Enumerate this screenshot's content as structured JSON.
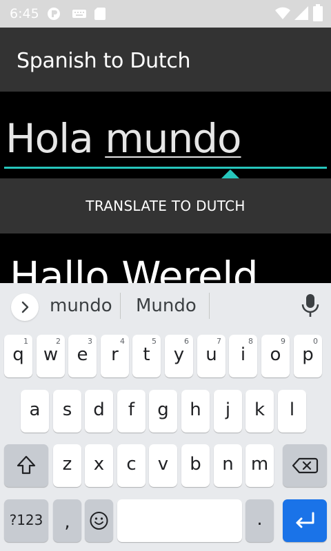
{
  "status_bar": {
    "time": "6:45",
    "left_icons": [
      "app-notification-icon",
      "keyboard-icon",
      "sd-card-icon"
    ],
    "right_icons": [
      "wifi-icon",
      "signal-icon",
      "battery-icon"
    ]
  },
  "app_bar": {
    "title": "Spanish to Dutch"
  },
  "input": {
    "text_plain": "Hola ",
    "text_composing": "mundo"
  },
  "translate_button": {
    "label": "TRANSLATE TO DUTCH"
  },
  "output": {
    "text": "Hallo Wereld"
  },
  "keyboard": {
    "suggestions": [
      "mundo",
      "Mundo"
    ],
    "row1": [
      {
        "ch": "q",
        "hint": "1"
      },
      {
        "ch": "w",
        "hint": "2"
      },
      {
        "ch": "e",
        "hint": "3"
      },
      {
        "ch": "r",
        "hint": "4"
      },
      {
        "ch": "t",
        "hint": "5"
      },
      {
        "ch": "y",
        "hint": "6"
      },
      {
        "ch": "u",
        "hint": "7"
      },
      {
        "ch": "i",
        "hint": "8"
      },
      {
        "ch": "o",
        "hint": "9"
      },
      {
        "ch": "p",
        "hint": "0"
      }
    ],
    "row2": [
      "a",
      "s",
      "d",
      "f",
      "g",
      "h",
      "j",
      "k",
      "l"
    ],
    "row3": [
      "z",
      "x",
      "c",
      "v",
      "b",
      "n",
      "m"
    ],
    "symbols_label": "?123",
    "comma": ",",
    "period": "."
  },
  "colors": {
    "accent": "#26c6bc",
    "app_bar": "#333333",
    "enter_key": "#1a73e8",
    "keyboard_bg": "#e8eaed"
  }
}
